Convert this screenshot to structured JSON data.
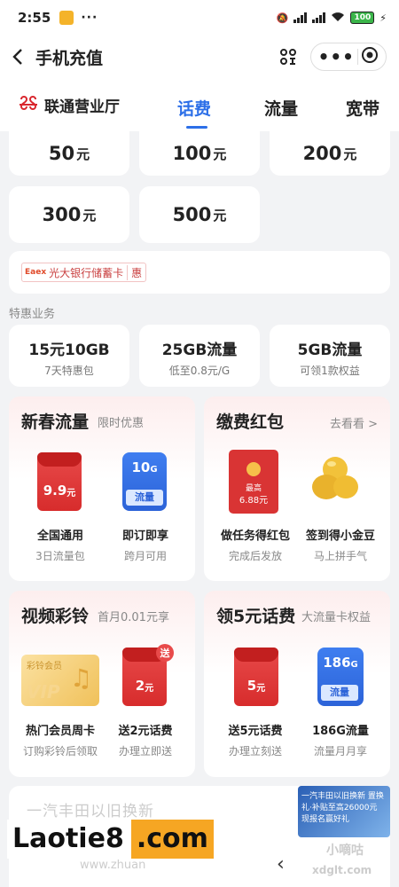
{
  "status": {
    "time": "2:55",
    "battery": "100"
  },
  "header": {
    "title": "手机充值"
  },
  "tabs": {
    "brand": "联通营业厅",
    "items": [
      "话费",
      "流量",
      "宽带"
    ]
  },
  "amounts": [
    {
      "num": "50",
      "unit": "元"
    },
    {
      "num": "100",
      "unit": "元"
    },
    {
      "num": "200",
      "unit": "元"
    },
    {
      "num": "300",
      "unit": "元"
    },
    {
      "num": "500",
      "unit": "元"
    }
  ],
  "bank": {
    "logo": "Eaex",
    "label": "光大银行储蓄卡",
    "badge": "惠"
  },
  "section": {
    "title": "特惠业务"
  },
  "packages": [
    {
      "title": "15元10GB",
      "sub": "7天特惠包"
    },
    {
      "title": "25GB流量",
      "sub": "低至0.8元/G"
    },
    {
      "title": "5GB流量",
      "sub": "可领1款权益"
    }
  ],
  "promos": {
    "spring": {
      "title": "新春流量",
      "tag": "限时优惠",
      "items": [
        {
          "name": "全国通用",
          "sub": "3日流量包",
          "price": "9.9",
          "unit": "元"
        },
        {
          "name": "即订即享",
          "sub": "跨月可用",
          "price": "10",
          "unit": "G",
          "label": "流量"
        }
      ]
    },
    "redpacket": {
      "title": "缴费红包",
      "more": "去看看 >",
      "items": [
        {
          "name": "做任务得红包",
          "sub": "完成后发放",
          "top": "最高",
          "amount": "6.88元"
        },
        {
          "name": "签到得小金豆",
          "sub": "马上拼手气"
        }
      ]
    },
    "ringtone": {
      "title": "视频彩铃",
      "tag": "首月0.01元享",
      "items": [
        {
          "name": "热门会员周卡",
          "sub": "订购彩铃后领取",
          "vip_label": "彩铃会员",
          "vip": "VIP"
        },
        {
          "name": "送2元话费",
          "sub": "办理立即送",
          "price": "2",
          "unit": "元",
          "badge": "送"
        }
      ]
    },
    "five": {
      "title": "领5元话费",
      "tag": "大流量卡权益",
      "items": [
        {
          "name": "送5元话费",
          "sub": "办理立刻送",
          "price": "5",
          "unit": "元"
        },
        {
          "name": "186G流量",
          "sub": "流量月月享",
          "price": "186",
          "unit": "G",
          "label": "流量"
        }
      ]
    }
  },
  "bottom": {
    "faded_text": "一汽丰田以旧换新",
    "faded_sub": "www.zhuan",
    "ad_text": "一汽丰田以旧换新 置换礼·补贴至高26000元 现报名赢好礼",
    "watermark1": "Laotie8",
    "watermark2": ".com",
    "corner1": "小嘀咕",
    "corner2": "xdglt.com"
  }
}
